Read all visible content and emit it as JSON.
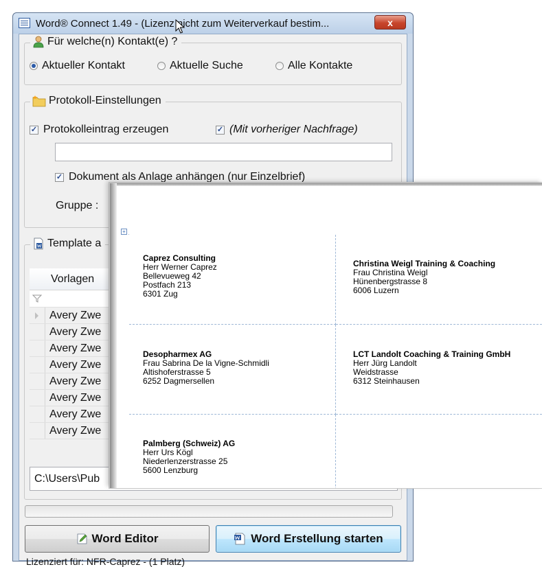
{
  "window": {
    "title": "Word® Connect 1.49 - (Lizenz nicht zum Weiterverkauf bestim...",
    "close_label": "x"
  },
  "contacts_group": {
    "legend": "Für welche(n) Kontakt(e) ?",
    "options": [
      {
        "label": "Aktueller Kontakt",
        "selected": true
      },
      {
        "label": "Aktuelle Suche",
        "selected": false
      },
      {
        "label": "Alle Kontakte",
        "selected": false
      }
    ]
  },
  "protocol_group": {
    "legend": "Protokoll-Einstellungen",
    "create_entry_label": "Protokolleintrag erzeugen",
    "create_entry_checked": true,
    "confirm_label": "(Mit vorheriger Nachfrage)",
    "confirm_checked": true,
    "entry_text_value": "",
    "attach_label": "Dokument als Anlage anhängen (nur Einzelbrief)",
    "attach_checked": true,
    "group_label": "Gruppe :"
  },
  "template_group": {
    "legend": "Template a",
    "column_header": "Vorlagen",
    "rows": [
      "Avery Zwe",
      "Avery Zwe",
      "Avery Zwe",
      "Avery Zwe",
      "Avery Zwe",
      "Avery Zwe",
      "Avery Zwe",
      "Avery Zwe"
    ],
    "path_value": "C:\\Users\\Pub"
  },
  "progress_value": 0,
  "buttons": {
    "word_editor": "Word Editor",
    "word_start": "Word Erstellung starten"
  },
  "status": "Lizenziert für: NFR-Caprez - (1 Platz)",
  "labels": [
    {
      "lines": [
        "Caprez Consulting",
        "Herr Werner Caprez",
        "Bellevueweg 42",
        "Postfach 213",
        "6301 Zug"
      ]
    },
    {
      "lines": [
        "Christina Weigl Training & Coaching",
        "Frau Christina Weigl",
        "Hünenbergstrasse 8",
        "6006 Luzern"
      ]
    },
    {
      "lines": [
        "Desopharmex AG",
        "Frau Sabrina De la Vigne-Schmidli",
        "Altishoferstrasse 5",
        "6252 Dagmersellen"
      ]
    },
    {
      "lines": [
        "LCT Landolt Coaching & Training GmbH",
        "Herr Jürg Landolt",
        "Weidstrasse",
        "6312 Steinhausen"
      ]
    },
    {
      "lines": [
        "Palmberg (Schweiz) AG",
        "Herr Urs Kögl",
        "Niederlenzerstrasse 25",
        "5600 Lenzburg"
      ]
    }
  ],
  "icons": [
    "word-app-icon",
    "contact-person-icon",
    "folder-star-icon",
    "template-doc-icon",
    "filter-icon",
    "edit-doc-icon",
    "word-doc-icon",
    "mouse-cursor-icon",
    "table-anchor-icon"
  ]
}
